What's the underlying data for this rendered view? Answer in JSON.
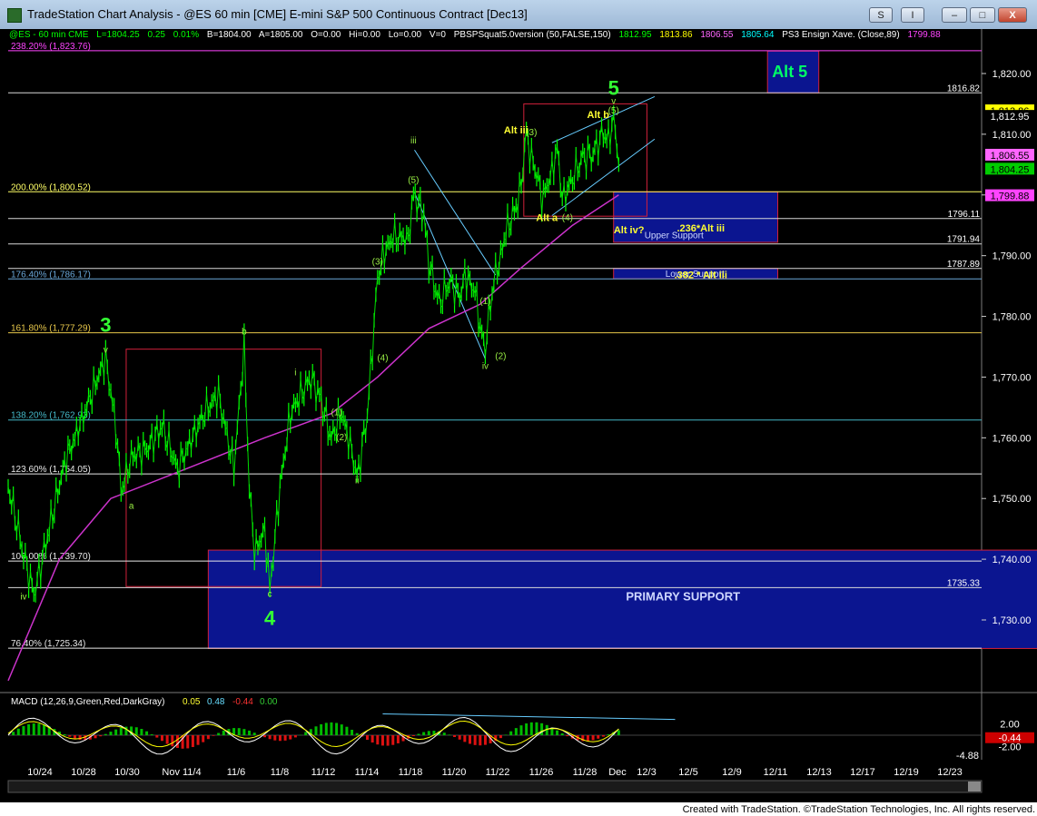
{
  "window": {
    "title": "TradeStation Chart Analysis - @ES 60 min [CME] E-mini S&P 500 Continuous Contract [Dec13]",
    "buttons": {
      "s": "S",
      "i": "I",
      "minimize": "–",
      "maximize": "□",
      "close": "X"
    }
  },
  "infobar": {
    "symbol": "@ES - 60 min  CME",
    "last": "L=1804.25",
    "chg": "0.25",
    "pct": "0.01%",
    "bid": "B=1804.00",
    "ask": "A=1805.00",
    "open": "O=0.00",
    "hi": "Hi=0.00",
    "lo": "Lo=0.00",
    "vol": "V=0",
    "indicator": "PBSPSquat5.0version (50,FALSE,150)",
    "ind_v1": "1812.95",
    "ind_v2": "1813.86",
    "ind_v3": "1806.55",
    "ind_v4": "1805.64",
    "ind2": "PS3 Ensign Xave. (Close,89)",
    "ind2_v": "1799.88"
  },
  "status": "Created with TradeStation. ©TradeStation Technologies, Inc. All rights reserved.",
  "chart_data": [
    {
      "type": "candlestick",
      "symbol": "@ES",
      "interval": "60 min",
      "ylim": [
        1720,
        1824
      ],
      "y_ticks": [
        1730,
        1740,
        1750,
        1760,
        1770,
        1780,
        1790,
        1800,
        1810,
        1820
      ],
      "y_tick_labels": [
        "1,730.00",
        "1,740.00",
        "1,750.00",
        "1,760.00",
        "1,770.00",
        "1,780.00",
        "1,790.00",
        "1,800.00",
        "1,810.00",
        "1,820.00"
      ],
      "x_tick_labels": [
        "10/24",
        "10/28",
        "10/30",
        "Nov 11/4",
        "11/6",
        "11/8",
        "11/12",
        "11/14",
        "11/18",
        "11/20",
        "11/22",
        "11/26",
        "11/28",
        "Dec",
        "12/3",
        "12/5",
        "12/9",
        "12/11",
        "12/13",
        "12/17",
        "12/19",
        "12/23"
      ],
      "price_path": [
        [
          0,
          1752
        ],
        [
          3,
          1741
        ],
        [
          5,
          1734
        ],
        [
          8,
          1745
        ],
        [
          11,
          1756
        ],
        [
          14,
          1762
        ],
        [
          17,
          1769
        ],
        [
          19,
          1773
        ],
        [
          21,
          1762
        ],
        [
          22,
          1751
        ],
        [
          24,
          1757
        ],
        [
          27,
          1758
        ],
        [
          30,
          1762
        ],
        [
          33,
          1755
        ],
        [
          36,
          1760
        ],
        [
          38,
          1764
        ],
        [
          41,
          1767
        ],
        [
          44,
          1755
        ],
        [
          46,
          1775
        ],
        [
          47,
          1752
        ],
        [
          48,
          1741
        ],
        [
          50,
          1745
        ],
        [
          51,
          1735
        ],
        [
          53,
          1752
        ],
        [
          55,
          1764
        ],
        [
          57,
          1767
        ],
        [
          59,
          1770
        ],
        [
          61,
          1766
        ],
        [
          63,
          1760
        ],
        [
          65,
          1764
        ],
        [
          67,
          1758
        ],
        [
          68,
          1753
        ],
        [
          70,
          1764
        ],
        [
          71,
          1775
        ],
        [
          72,
          1786
        ],
        [
          73,
          1790
        ],
        [
          75,
          1793
        ],
        [
          78,
          1793
        ],
        [
          79,
          1800
        ],
        [
          81,
          1797
        ],
        [
          82,
          1789
        ],
        [
          84,
          1782
        ],
        [
          86,
          1786
        ],
        [
          88,
          1783
        ],
        [
          89,
          1787
        ],
        [
          91,
          1784
        ],
        [
          92,
          1778
        ],
        [
          93,
          1775
        ],
        [
          94,
          1782
        ],
        [
          95,
          1787
        ],
        [
          96,
          1790
        ],
        [
          97,
          1794
        ],
        [
          99,
          1798
        ],
        [
          100,
          1802
        ],
        [
          101,
          1810
        ],
        [
          102,
          1806
        ],
        [
          103,
          1804
        ],
        [
          104,
          1799
        ],
        [
          106,
          1804
        ],
        [
          107,
          1808
        ],
        [
          108,
          1799
        ],
        [
          110,
          1803
        ],
        [
          112,
          1806
        ],
        [
          114,
          1807
        ],
        [
          116,
          1810
        ],
        [
          117,
          1809
        ],
        [
          118,
          1813
        ],
        [
          119,
          1805
        ]
      ],
      "moving_average": [
        [
          0,
          1720
        ],
        [
          10,
          1740
        ],
        [
          20,
          1750
        ],
        [
          35,
          1755
        ],
        [
          50,
          1760
        ],
        [
          63,
          1764
        ],
        [
          72,
          1770
        ],
        [
          82,
          1778
        ],
        [
          92,
          1782
        ],
        [
          100,
          1788
        ],
        [
          110,
          1795
        ],
        [
          119,
          1800
        ]
      ],
      "current_price": 1804.25,
      "price_labels": {
        "top1": "1,813.86",
        "top2": "1,812.95",
        "mid": "1,806.55",
        "cur": "1,804.25",
        "ma": "1,799.88"
      },
      "fib_levels": [
        {
          "label": "238.20% (1,823.76)",
          "value": 1823.76
        },
        {
          "label": "200.00% (1,800.52)",
          "value": 1800.52
        },
        {
          "label": "176.40% (1,786.17)",
          "value": 1786.17
        },
        {
          "label": "161.80% (1,777.29)",
          "value": 1777.29
        },
        {
          "label": "138.20% (1,762.93)",
          "value": 1762.93
        },
        {
          "label": "123.60% (1,754.05)",
          "value": 1754.05
        },
        {
          "label": "100.00% (1,739.70)",
          "value": 1739.7
        },
        {
          "label": "76.40% (1,725.34)",
          "value": 1725.34
        }
      ],
      "hlines": [
        {
          "label": "1816.82",
          "value": 1816.82
        },
        {
          "label": "1796.11",
          "value": 1796.11
        },
        {
          "label": "1791.94",
          "value": 1791.94
        },
        {
          "label": "1787.89",
          "value": 1787.89
        },
        {
          "label": "1735.33",
          "value": 1735.33
        }
      ],
      "zones": [
        {
          "label": "PRIMARY SUPPORT",
          "x0": 39,
          "x1": 220,
          "y0": 1725.3,
          "y1": 1741.5
        },
        {
          "label": "Upper  Support",
          "x0": 118,
          "x1": 150,
          "y0": 1792.2,
          "y1": 1800.5
        },
        {
          "label": "Lower Support",
          "x0": 118,
          "x1": 150,
          "y0": 1786.2,
          "y1": 1787.9
        },
        {
          "label": "Alt 5",
          "x0": 148,
          "x1": 158,
          "y0": 1816.8,
          "y1": 1823.7
        }
      ],
      "wave_labels": [
        {
          "text": "3",
          "x": 19,
          "y": 1777.5,
          "big": true
        },
        {
          "text": "4",
          "x": 51,
          "y": 1729.2,
          "big": true
        },
        {
          "text": "5",
          "x": 118,
          "y": 1816.5,
          "big": true
        },
        {
          "text": "v",
          "x": 19,
          "y": 1774.0
        },
        {
          "text": "iv",
          "x": 3,
          "y": 1733.4
        },
        {
          "text": "a",
          "x": 24,
          "y": 1748.3
        },
        {
          "text": "b",
          "x": 46,
          "y": 1777.0
        },
        {
          "text": "c",
          "x": 51,
          "y": 1733.8
        },
        {
          "text": "i",
          "x": 56,
          "y": 1770.3
        },
        {
          "text": "ii",
          "x": 68,
          "y": 1752.5
        },
        {
          "text": "iii",
          "x": 79,
          "y": 1808.5
        },
        {
          "text": "iv",
          "x": 93,
          "y": 1771.3
        },
        {
          "text": "(1)",
          "x": 64,
          "y": 1763.7
        },
        {
          "text": "(2)",
          "x": 65,
          "y": 1759.6
        },
        {
          "text": "(3)",
          "x": 72,
          "y": 1788.5
        },
        {
          "text": "(4)",
          "x": 73,
          "y": 1772.7
        },
        {
          "text": "(5)",
          "x": 79,
          "y": 1802.0
        },
        {
          "text": "(1)",
          "x": 93,
          "y": 1782.0
        },
        {
          "text": "(2)",
          "x": 96,
          "y": 1773.0
        },
        {
          "text": "(3)",
          "x": 102,
          "y": 1809.8
        },
        {
          "text": "(4)",
          "x": 109,
          "y": 1795.8
        },
        {
          "text": "(5)",
          "x": 118,
          "y": 1813.4
        },
        {
          "text": "v",
          "x": 118,
          "y": 1815.0
        },
        {
          "text": "Alt iii",
          "x": 99,
          "y": 1810.1,
          "yellow": true
        },
        {
          "text": "Alt b",
          "x": 115,
          "y": 1812.7,
          "yellow": true
        },
        {
          "text": "Alt a",
          "x": 105,
          "y": 1795.7,
          "yellow": true
        },
        {
          "text": "Alt iv?",
          "x": 121,
          "y": 1793.7,
          "yellow": true
        },
        {
          "text": ".236*Alt iii",
          "x": 135,
          "y": 1794.0,
          "yellow": true
        },
        {
          "text": ".382 * Alt iii",
          "x": 135,
          "y": 1786.3,
          "yellow": true
        }
      ]
    },
    {
      "type": "macd",
      "title": "MACD (12,26,9,Green,Red,DarkGray)",
      "values": {
        "macd": "0.05",
        "signal": "0.48",
        "diff": "-0.44",
        "zero": "0.00"
      },
      "ylim": [
        -4.88,
        4.5
      ],
      "y_tick_labels": [
        "2.00",
        "-2.00",
        "-4.88"
      ],
      "value_labels": {
        "last": "-0.44"
      }
    }
  ]
}
